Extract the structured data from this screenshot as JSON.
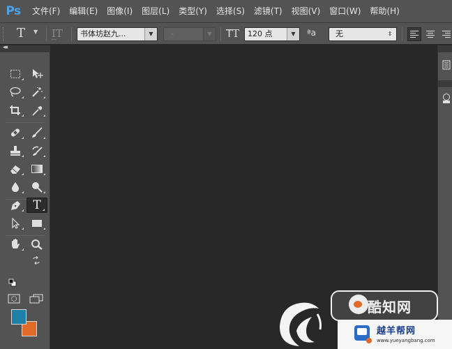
{
  "app": {
    "logo": "Ps",
    "accent": "#4da3e6"
  },
  "menu": [
    {
      "label": "文件(F)"
    },
    {
      "label": "编辑(E)"
    },
    {
      "label": "图像(I)"
    },
    {
      "label": "图层(L)"
    },
    {
      "label": "类型(Y)"
    },
    {
      "label": "选择(S)"
    },
    {
      "label": "滤镜(T)"
    },
    {
      "label": "视图(V)"
    },
    {
      "label": "窗口(W)"
    },
    {
      "label": "帮助(H)"
    }
  ],
  "options": {
    "tool_icon": "horizontal-type-icon",
    "font_family": "书体坊赵九...",
    "font_style": "-",
    "font_size": "120 点",
    "antialias": "无",
    "align": [
      "align-left",
      "align-center",
      "align-right"
    ]
  },
  "tools": [
    {
      "name": "rectangular-marquee-tool",
      "icon": "marquee-icon"
    },
    {
      "name": "move-tool",
      "icon": "move-icon"
    },
    {
      "name": "lasso-tool",
      "icon": "lasso-icon"
    },
    {
      "name": "magic-wand-tool",
      "icon": "magic-wand-icon"
    },
    {
      "name": "crop-tool",
      "icon": "crop-icon"
    },
    {
      "name": "eyedropper-tool",
      "icon": "eyedropper-icon"
    },
    {
      "name": "healing-brush-tool",
      "icon": "bandage-icon"
    },
    {
      "name": "brush-tool",
      "icon": "brush-icon"
    },
    {
      "name": "clone-stamp-tool",
      "icon": "stamp-icon"
    },
    {
      "name": "history-brush-tool",
      "icon": "history-brush-icon"
    },
    {
      "name": "eraser-tool",
      "icon": "eraser-icon"
    },
    {
      "name": "gradient-tool",
      "icon": "gradient-icon"
    },
    {
      "name": "blur-tool",
      "icon": "drop-icon"
    },
    {
      "name": "dodge-tool",
      "icon": "dodge-icon"
    },
    {
      "name": "pen-tool",
      "icon": "pen-icon"
    },
    {
      "name": "type-tool",
      "icon": "type-icon",
      "active": true
    },
    {
      "name": "path-selection-tool",
      "icon": "arrow-icon"
    },
    {
      "name": "rectangle-tool",
      "icon": "rectangle-icon"
    },
    {
      "name": "hand-tool",
      "icon": "hand-icon"
    },
    {
      "name": "zoom-tool",
      "icon": "zoom-icon"
    }
  ],
  "colors": {
    "foreground": "#1f7fa6",
    "background": "#e06a28"
  },
  "watermark": {
    "brand_cn": "酷知网",
    "site_cn": "越羊帮网",
    "site_url": "www.yueyangbang.com"
  }
}
